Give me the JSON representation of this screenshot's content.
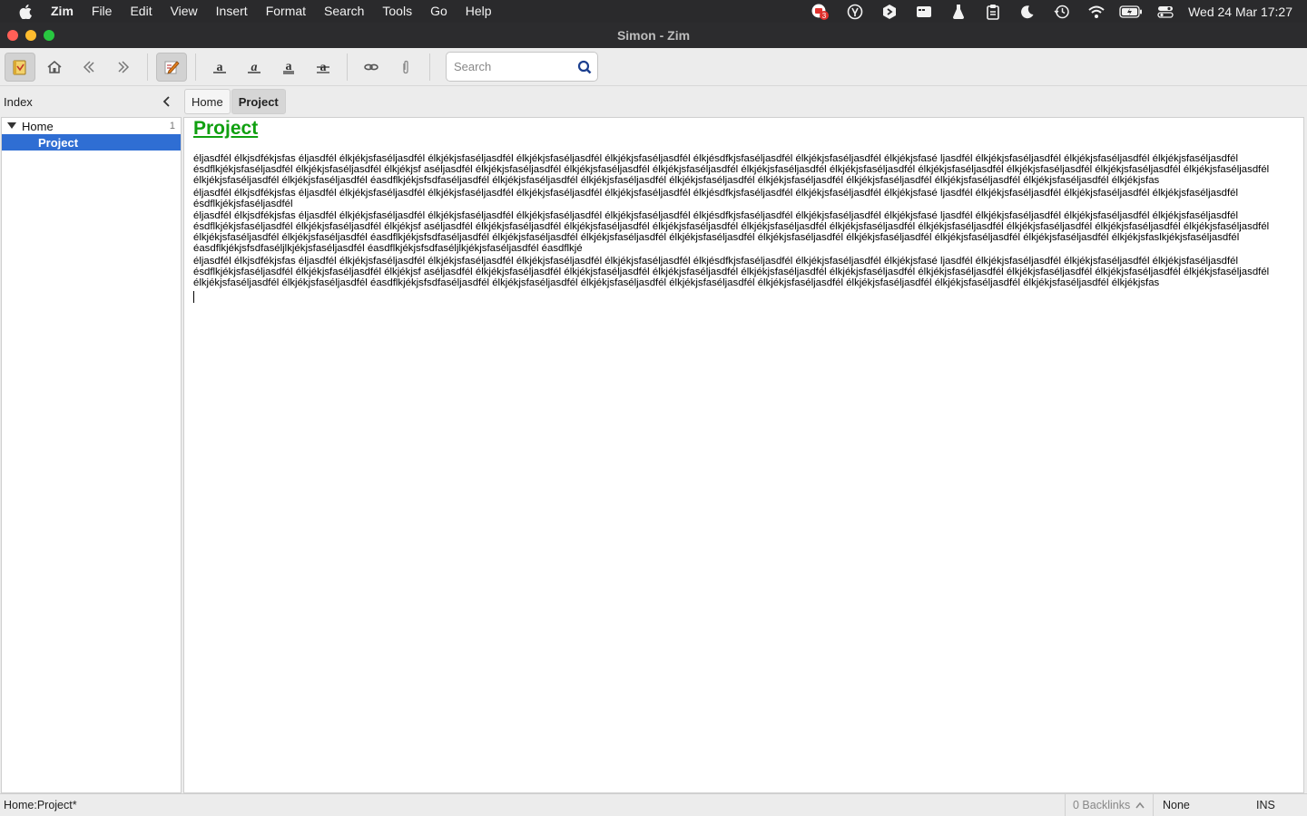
{
  "menubar": {
    "app_name": "Zim",
    "items": [
      "File",
      "Edit",
      "View",
      "Insert",
      "Format",
      "Search",
      "Tools",
      "Go",
      "Help"
    ],
    "badge_count": "3",
    "clock": "Wed 24 Mar  17:27",
    "status_icons": [
      "notification-badge-icon",
      "accessibility-icon",
      "script-icon",
      "window-icon",
      "flask-icon",
      "clipboard-icon",
      "moon-icon",
      "time-machine-icon",
      "wifi-icon",
      "battery-icon",
      "control-center-icon"
    ]
  },
  "window": {
    "title": "Simon - Zim",
    "traffic_colors": [
      "#ff5f57",
      "#febc2e",
      "#28c840"
    ]
  },
  "toolbar": {
    "search_placeholder": "Search",
    "buttons": [
      "notebook",
      "home",
      "back",
      "forward",
      "edit",
      "bold",
      "italic",
      "underline",
      "strike",
      "link",
      "attach"
    ]
  },
  "sidebar": {
    "title": "Index",
    "tree": [
      {
        "label": "Home",
        "count": "1",
        "expanded": true
      },
      {
        "label": "Project",
        "selected": true
      }
    ]
  },
  "pathbar": {
    "crumbs": [
      "Home",
      "Project"
    ]
  },
  "page": {
    "heading": "Project",
    "heading_color": "#10a010",
    "paragraphs": [
      "éljasdfél élkjsdfékjsfas éljasdfél élkjékjsfaséljasdfél élkjékjsfaséljasdfél élkjékjsfaséljasdfél élkjékjsfaséljasdfél élkjésdfkjsfaséljasdfél élkjékjsfaséljasdfél élkjékjsfasé ljasdfél élkjékjsfaséljasdfél élkjékjsfaséljasdfél élkjékjsfaséljasdfél ésdflkjékjsfaséljasdfél élkjékjsfaséljasdfél élkjékjsf aséljasdfél élkjékjsfaséljasdfél élkjékjsfaséljasdfél élkjékjsfaséljasdfél élkjékjsfaséljasdfél élkjékjsfaséljasdfél élkjékjsfaséljasdfél élkjékjsfaséljasdfél élkjékjsfaséljasdfél élkjékjsfaséljasdfél élkjékjsfaséljasdfél élkjékjsfaséljasdfél éasdflkjékjsfsdfaséljasdfél élkjékjsfaséljasdfél élkjékjsfaséljasdfél élkjékjsfaséljasdfél élkjékjsfaséljasdfél élkjékjsfaséljasdfél élkjékjsfaséljasdfél élkjékjsfaséljasdfél élkjékjsfas",
      "éljasdfél élkjsdfékjsfas éljasdfél élkjékjsfaséljasdfél élkjékjsfaséljasdfél élkjékjsfaséljasdfél élkjékjsfaséljasdfél élkjésdfkjsfaséljasdfél élkjékjsfaséljasdfél élkjékjsfasé ljasdfél élkjékjsfaséljasdfél élkjékjsfaséljasdfél élkjékjsfaséljasdfél ésdflkjékjsfaséljasdfél",
      "éljasdfél élkjsdfékjsfas éljasdfél élkjékjsfaséljasdfél élkjékjsfaséljasdfél élkjékjsfaséljasdfél élkjékjsfaséljasdfél élkjésdfkjsfaséljasdfél élkjékjsfaséljasdfél élkjékjsfasé ljasdfél élkjékjsfaséljasdfél élkjékjsfaséljasdfél élkjékjsfaséljasdfél ésdflkjékjsfaséljasdfél élkjékjsfaséljasdfél élkjékjsf aséljasdfél élkjékjsfaséljasdfél élkjékjsfaséljasdfél élkjékjsfaséljasdfél élkjékjsfaséljasdfél élkjékjsfaséljasdfél élkjékjsfaséljasdfél élkjékjsfaséljasdfél élkjékjsfaséljasdfél élkjékjsfaséljasdfél élkjékjsfaséljasdfél élkjékjsfaséljasdfél éasdflkjékjsfsdfaséljasdfél élkjékjsfaséljasdfél élkjékjsfaséljasdfél élkjékjsfaséljasdfél élkjékjsfaséljasdfél élkjékjsfaséljasdfél élkjékjsfaséljasdfél élkjékjsfaséljasdfél élkjékjsfaslkjékjsfaséljasdfél éasdflkjékjsfsdfaséljlkjékjsfaséljasdfél éasdflkjékjsfsdfaséljlkjékjsfaséljasdfél éasdflkjé",
      "éljasdfél élkjsdfékjsfas éljasdfél élkjékjsfaséljasdfél élkjékjsfaséljasdfél élkjékjsfaséljasdfél élkjékjsfaséljasdfél élkjésdfkjsfaséljasdfél élkjékjsfaséljasdfél élkjékjsfasé ljasdfél élkjékjsfaséljasdfél élkjékjsfaséljasdfél élkjékjsfaséljasdfél ésdflkjékjsfaséljasdfél élkjékjsfaséljasdfél élkjékjsf aséljasdfél élkjékjsfaséljasdfél élkjékjsfaséljasdfél élkjékjsfaséljasdfél élkjékjsfaséljasdfél élkjékjsfaséljasdfél élkjékjsfaséljasdfél élkjékjsfaséljasdfél élkjékjsfaséljasdfél élkjékjsfaséljasdfél élkjékjsfaséljasdfél élkjékjsfaséljasdfél éasdflkjékjsfsdfaséljasdfél élkjékjsfaséljasdfél élkjékjsfaséljasdfél élkjékjsfaséljasdfél élkjékjsfaséljasdfél élkjékjsfaséljasdfél élkjékjsfaséljasdfél élkjékjsfaséljasdfél élkjékjsfas"
    ]
  },
  "statusbar": {
    "path": "Home:Project*",
    "backlinks": "0 Backlinks",
    "style": "None",
    "mode": "INS"
  }
}
